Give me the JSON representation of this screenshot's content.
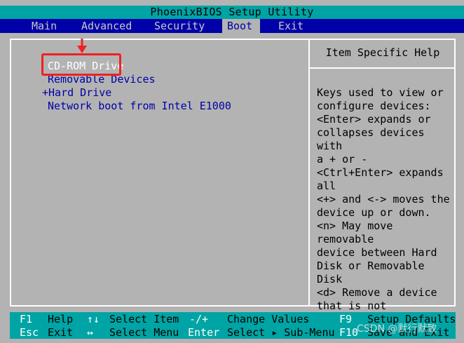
{
  "title": "PhoenixBIOS Setup Utility",
  "menu": {
    "items": [
      {
        "label": "Main"
      },
      {
        "label": "Advanced"
      },
      {
        "label": "Security"
      },
      {
        "label": "Boot",
        "active": true
      },
      {
        "label": "Exit"
      }
    ]
  },
  "boot_list": [
    {
      "label": "CD-ROM Drive",
      "selected": true
    },
    {
      "label": "Removable Devices"
    },
    {
      "label": "+Hard Drive"
    },
    {
      "label": "Network boot from Intel E1000"
    }
  ],
  "help": {
    "title": "Item Specific Help",
    "text": "Keys used to view or\nconfigure devices:\n<Enter> expands or\ncollapses devices with\na + or -\n<Ctrl+Enter> expands\nall\n<+> and <-> moves the\ndevice up or down.\n<n> May move removable\ndevice between Hard\nDisk or Removable Disk\n<d> Remove a device\nthat is not installed."
  },
  "footer": {
    "row1": [
      {
        "key": "F1",
        "desc": "Help"
      },
      {
        "key": "↑↓",
        "desc": "Select Item"
      },
      {
        "key": "-/+",
        "desc": "Change Values"
      },
      {
        "key": "F9",
        "desc": "Setup Defaults"
      }
    ],
    "row2": [
      {
        "key": "Esc",
        "desc": "Exit"
      },
      {
        "key": "↔",
        "desc": "Select Menu"
      },
      {
        "key": "Enter",
        "desc": "Select ▸ Sub-Menu"
      },
      {
        "key": "F10",
        "desc": "Save and Exit"
      }
    ]
  },
  "watermark": "CSDN @默行默致",
  "colors": {
    "title_bg": "#00a4a4",
    "menubar_bg": "#0000a8",
    "body_bg": "#b3b3b3",
    "annotation": "#ee2222"
  }
}
